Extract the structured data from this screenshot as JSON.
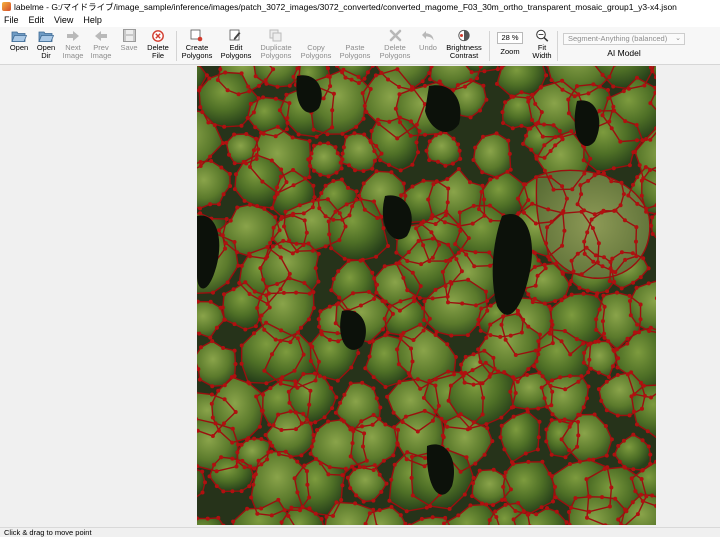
{
  "window": {
    "title": "labelme - G:/マイドライブ/image_sample/inference/images/patch_3072_images/3072_converted/converted_magome_F03_30m_ortho_transparent_mosaic_group1_y3-x4.json"
  },
  "menu": {
    "file": "File",
    "edit": "Edit",
    "view": "View",
    "help": "Help"
  },
  "toolbar": {
    "open": "Open",
    "open_dir": [
      "Open",
      "Dir"
    ],
    "next_image": [
      "Next",
      "Image"
    ],
    "prev_image": [
      "Prev",
      "Image"
    ],
    "save": "Save",
    "delete_file": [
      "Delete",
      "File"
    ],
    "create_polygons": [
      "Create",
      "Polygons"
    ],
    "edit_polygons": [
      "Edit",
      "Polygons"
    ],
    "duplicate_polygons": [
      "Duplicate",
      "Polygons"
    ],
    "copy_polygons": [
      "Copy",
      "Polygons"
    ],
    "paste_polygons": [
      "Paste",
      "Polygons"
    ],
    "delete_polygons": [
      "Delete",
      "Polygons"
    ],
    "undo": "Undo",
    "brightness_contrast": [
      "Brightness",
      "Contrast"
    ],
    "zoom_value": "28 %",
    "zoom_label": "Zoom",
    "fit_width": [
      "Fit",
      "Width"
    ],
    "ai_model_select": "Segment-Anything (balanced)",
    "ai_model_label": "AI Model"
  },
  "status": {
    "text": "Click & drag to move point"
  },
  "colors": {
    "polygon_outline": "#9b0f0f",
    "vertex": "#b01010",
    "canvas_dark": "#1c2414",
    "canvas_green": "#4a6a2a",
    "disabled_text": "#8d8d8d"
  }
}
